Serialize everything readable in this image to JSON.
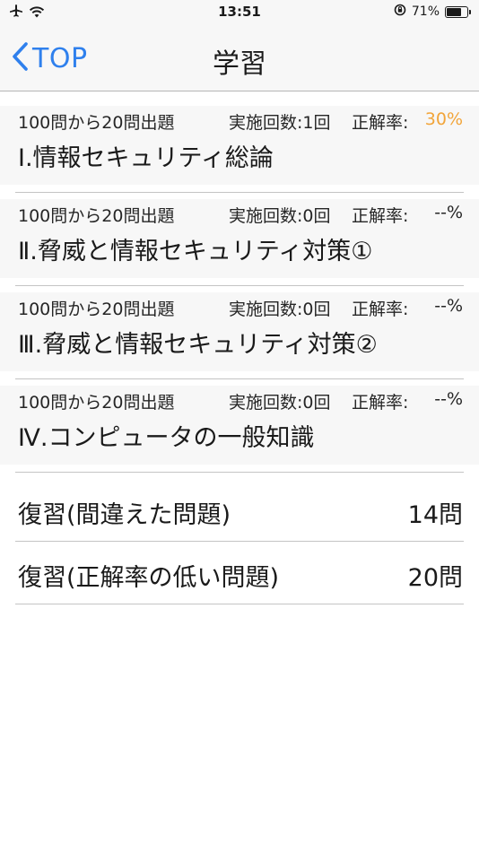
{
  "status": {
    "time": "13:51",
    "battery_percent": "71%",
    "battery_level": 0.71
  },
  "nav": {
    "back_label": "TOP",
    "title": "学習"
  },
  "courses": [
    {
      "questions": "100問から20問出題",
      "count": "実施回数:1回",
      "rate_label": "正解率:",
      "rate": "30%",
      "title": "Ⅰ.情報セキュリティ総論"
    },
    {
      "questions": "100問から20問出題",
      "count": "実施回数:0回",
      "rate_label": "正解率:",
      "rate": "--%",
      "title": "Ⅱ.脅威と情報セキュリティ対策①"
    },
    {
      "questions": "100問から20問出題",
      "count": "実施回数:0回",
      "rate_label": "正解率:",
      "rate": "--%",
      "title": "Ⅲ.脅威と情報セキュリティ対策②"
    },
    {
      "questions": "100問から20問出題",
      "count": "実施回数:0回",
      "rate_label": "正解率:",
      "rate": "--%",
      "title": "Ⅳ.コンピュータの一般知識"
    }
  ],
  "review": [
    {
      "label": "復習(間違えた問題)",
      "value": "14問"
    },
    {
      "label": "復習(正解率の低い問題)",
      "value": "20問"
    }
  ],
  "colors": {
    "accent_blue": "#2f80ed",
    "rate_highlight": "#f2a53a"
  }
}
